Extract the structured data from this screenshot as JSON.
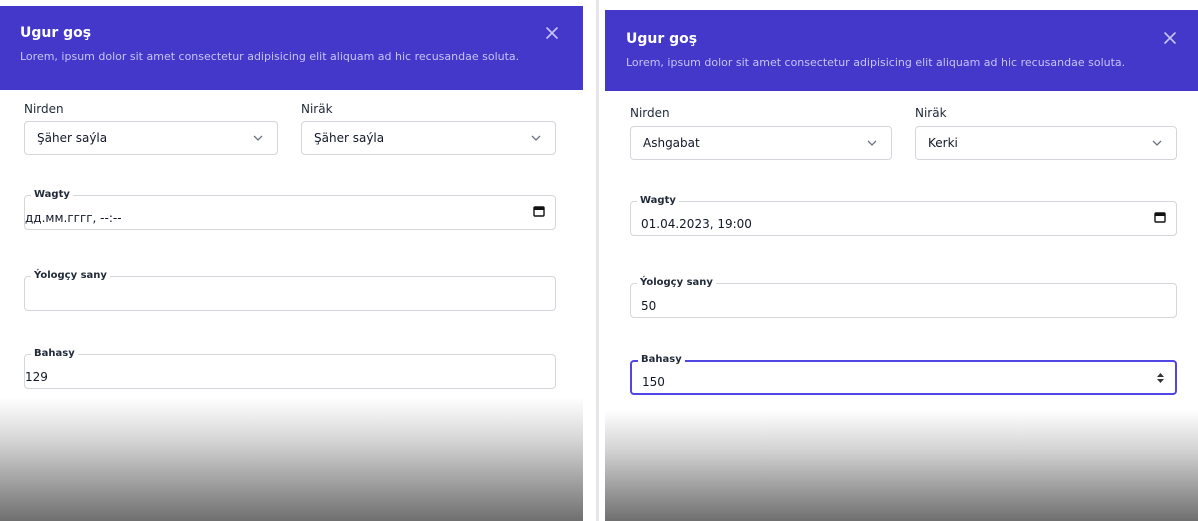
{
  "left": {
    "title": "Ugur goş",
    "subtitle": "Lorem, ipsum dolor sit amet consectetur adipisicing elit aliquam ad hic recusandae soluta.",
    "from_label": "Nirden",
    "from_value": "Şäher saýla",
    "to_label": "Niräk",
    "to_value": "Şäher saýla",
    "time_label": "Wagty",
    "time_value": "дд.мм.гггг, --:--",
    "passengers_label": "Ýologçy sany",
    "passengers_value": "",
    "price_label": "Bahasy",
    "price_value": "129"
  },
  "right": {
    "title": "Ugur goş",
    "subtitle": "Lorem, ipsum dolor sit amet consectetur adipisicing elit aliquam ad hic recusandae soluta.",
    "from_label": "Nirden",
    "from_value": "Ashgabat",
    "to_label": "Niräk",
    "to_value": "Kerki",
    "time_label": "Wagty",
    "time_value": "01.04.2023, 19:00",
    "passengers_label": "Ýologçy sany",
    "passengers_value": "50",
    "price_label": "Bahasy",
    "price_value": "150"
  },
  "colors": {
    "header": "#4338ca",
    "focus_border": "#4f46e5"
  },
  "icons": [
    "close-icon",
    "chevron-down-icon",
    "calendar-icon",
    "spinner-arrows-icon"
  ]
}
